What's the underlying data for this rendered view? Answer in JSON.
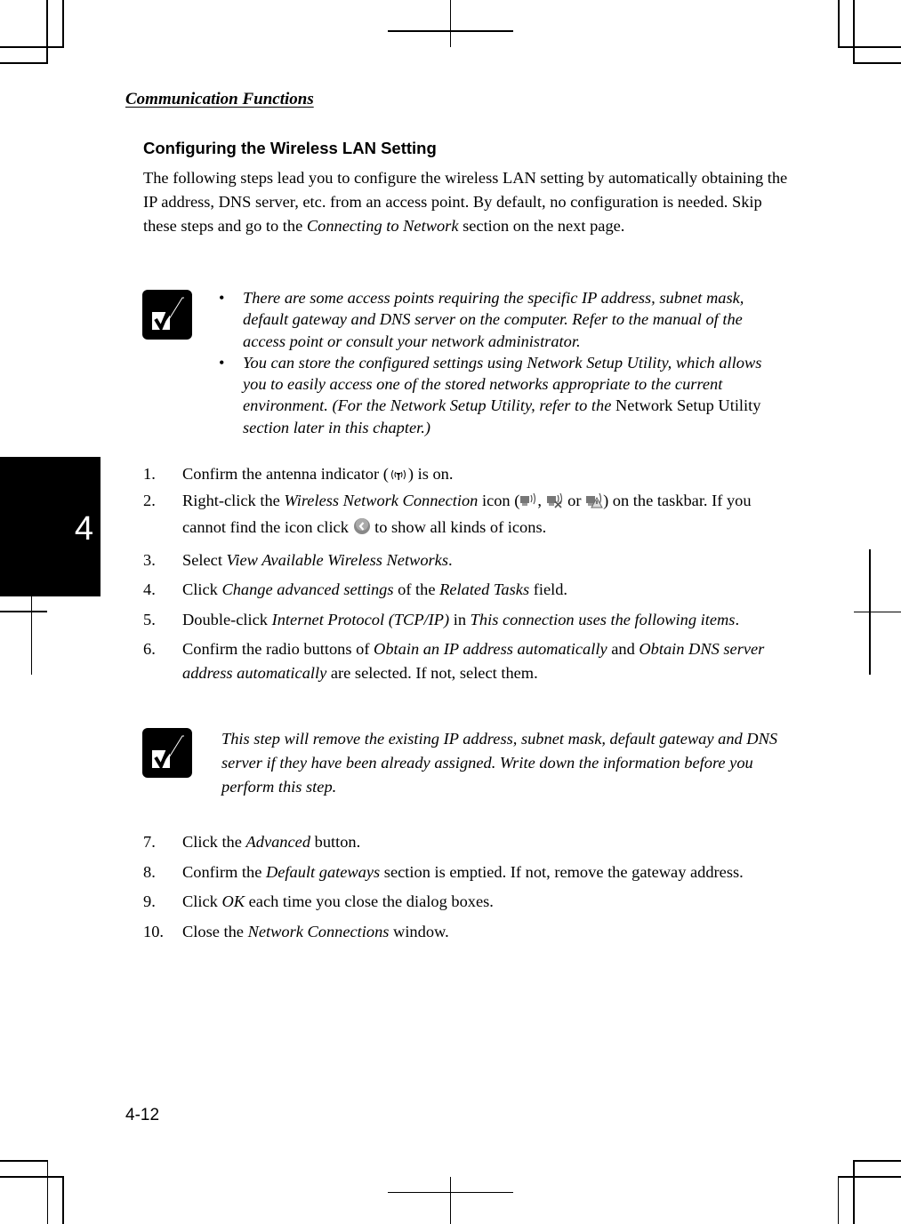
{
  "running_header": "Communication Functions",
  "section_title": "Configuring the Wireless LAN Setting",
  "intro": {
    "part1": "The following steps lead you to configure the wireless LAN setting by automatically obtaining the IP address, DNS server, etc. from an access point. By default, no configuration is needed. Skip these steps and go to the ",
    "link_ref": "Connecting to Network",
    "part2": " section on the next page."
  },
  "note1": {
    "icon": "checkmark-note-icon",
    "items": [
      {
        "text": "There are some access points requiring the specific IP address, subnet mask, default gateway and DNS server on the computer. Refer to the manual of the access point or consult your network administrator."
      },
      {
        "text_a": "You can store the configured settings using Network Setup Utility, which allows you to easily access one of the stored networks appropriate to the current environment. (For the Network Setup Utility, refer to the ",
        "ref": "Network Setup Utility",
        "text_b": " section later in this chapter.)"
      }
    ],
    "bullet": "•"
  },
  "steps_a": [
    {
      "num": "1.",
      "a": "Confirm the antenna indicator (",
      "icon": "antenna-indicator-icon",
      "b": ") is on."
    },
    {
      "num": "2.",
      "a": "Right-click the ",
      "em": "Wireless Network Connection",
      "b": " icon (",
      "sep1": ", ",
      "sep2": " or ",
      "c": ") on the taskbar. If you cannot find the icon click ",
      "d": " to show all kinds of icons.",
      "icons": [
        "wireless-connected-icon",
        "wireless-disconnected-icon",
        "wireless-limited-icon",
        "show-hidden-icons-icon"
      ]
    },
    {
      "num": "3.",
      "a": "Select ",
      "em": "View Available Wireless Networks",
      "b": "."
    },
    {
      "num": "4.",
      "a": "Click ",
      "em": "Change advanced settings",
      "b": " of the ",
      "em2": "Related Tasks",
      "c": " field."
    },
    {
      "num": "5.",
      "a": "Double-click ",
      "em": "Internet Protocol (TCP/IP)",
      "b": " in ",
      "em2": "This connection uses the following items",
      "c": "."
    },
    {
      "num": "6.",
      "a": "Confirm the radio buttons of ",
      "em": "Obtain an IP address automatically",
      "b": " and ",
      "em2": "Obtain DNS server address automatically",
      "c": " are selected. If not, select them."
    }
  ],
  "note2": {
    "icon": "checkmark-note-icon",
    "text": "This step will remove the existing IP address, subnet mask, default gateway and DNS server if they have been already assigned. Write down the information before you perform this step."
  },
  "steps_b": [
    {
      "num": "7.",
      "a": "Click the ",
      "em": "Advanced",
      "b": " button."
    },
    {
      "num": "8.",
      "a": "Confirm the ",
      "em": "Default gateways",
      "b": " section is emptied. If not, remove the gateway address."
    },
    {
      "num": "9.",
      "a": "Click ",
      "em": "OK",
      "b": " each time you close the dialog boxes."
    },
    {
      "num": "10.",
      "a": "Close the ",
      "em": "Network Connections",
      "b": " window."
    }
  ],
  "chapter_tab": "4",
  "page_number": "4-12"
}
